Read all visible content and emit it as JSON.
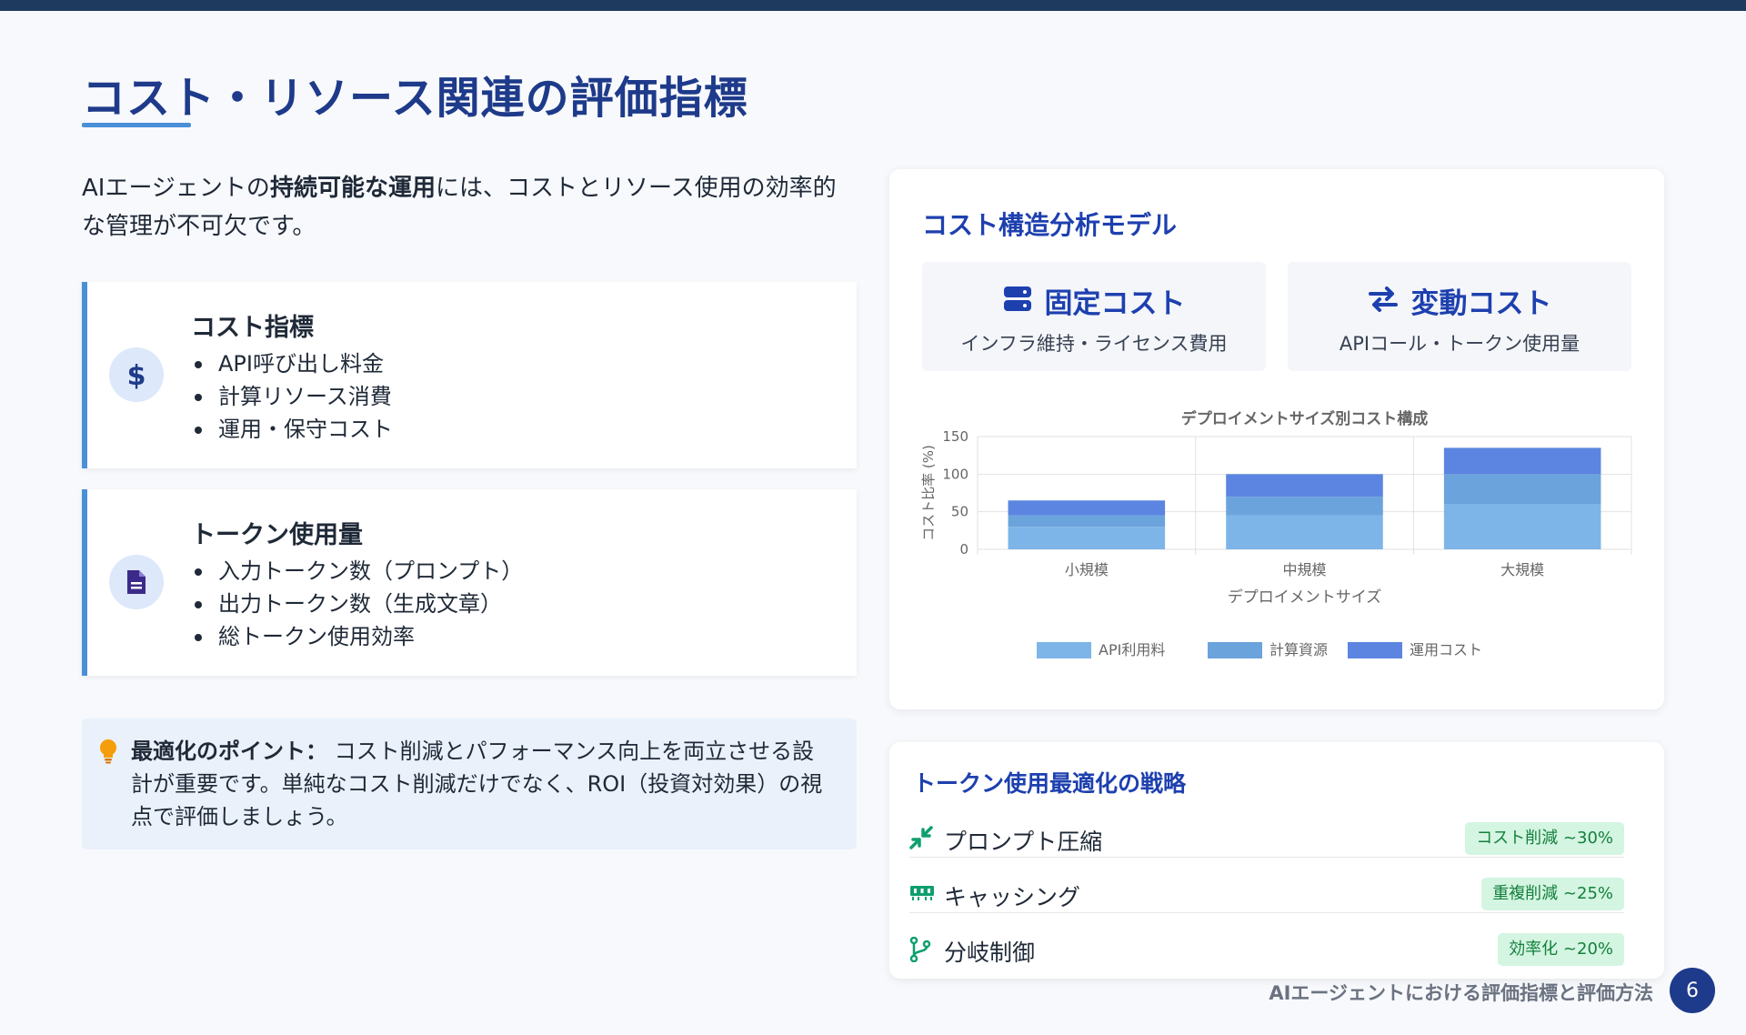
{
  "page": {
    "title": "コスト・リソース関連の評価指標",
    "intro_prefix": "AIエージェントの",
    "intro_bold": "持続可能な運用",
    "intro_suffix": "には、コストとリソース使用の効率的な管理が不可欠です。"
  },
  "cards": [
    {
      "title": "コスト指標",
      "icon": "dollar-icon",
      "items": [
        "API呼び出し料金",
        "計算リソース消費",
        "運用・保守コスト"
      ]
    },
    {
      "title": "トークン使用量",
      "icon": "document-icon",
      "items": [
        "入力トークン数（プロンプト）",
        "出力トークン数（生成文章）",
        "総トークン使用効率"
      ]
    }
  ],
  "tip": {
    "icon": "lightbulb-icon",
    "label": "最適化のポイント：",
    "text": "コスト削減とパフォーマンス向上を両立させる設計が重要です。単純なコスト削減だけでなく、ROI（投資対効果）の視点で評価しましょう。"
  },
  "cost_model": {
    "title": "コスト構造分析モデル",
    "fixed": {
      "title": "固定コスト",
      "subtitle": "インフラ維持・ライセンス費用",
      "icon": "server-icon"
    },
    "variable": {
      "title": "変動コスト",
      "subtitle": "APIコール・トークン使用量",
      "icon": "exchange-arrows-icon"
    }
  },
  "chart_data": {
    "type": "bar",
    "stacked": true,
    "title": "デプロイメントサイズ別コスト構成",
    "xlabel": "デプロイメントサイズ",
    "ylabel": "コスト比率 (%)",
    "categories": [
      "小規模",
      "中規模",
      "大規模"
    ],
    "ylim": [
      0,
      150
    ],
    "yticks": [
      0,
      50,
      100,
      150
    ],
    "grid": true,
    "legend_position": "bottom",
    "series": [
      {
        "name": "API利用料",
        "values": [
          30,
          45,
          60
        ],
        "color": "#7db5e8"
      },
      {
        "name": "計算資源",
        "values": [
          15,
          25,
          40
        ],
        "color": "#6ba3dc"
      },
      {
        "name": "運用コスト",
        "values": [
          20,
          30,
          35
        ],
        "color": "#5b85e0"
      }
    ]
  },
  "strategies": {
    "title": "トークン使用最適化の戦略",
    "items": [
      {
        "label": "プロンプト圧縮",
        "badge": "コスト削減 ~30%",
        "icon": "compress-icon"
      },
      {
        "label": "キャッシング",
        "badge": "重複削減 ~25%",
        "icon": "memory-icon"
      },
      {
        "label": "分岐制御",
        "badge": "効率化 ~20%",
        "icon": "branch-icon"
      }
    ]
  },
  "footer": {
    "text": "AIエージェントにおける評価指標と評価方法",
    "page_number": "6"
  },
  "colors": {
    "title": "#1e3a8a",
    "accent": "#4a90d9",
    "topbar": "#1e3a5f",
    "badge_bg": "#d4f5e2",
    "badge_text": "#15803d"
  }
}
